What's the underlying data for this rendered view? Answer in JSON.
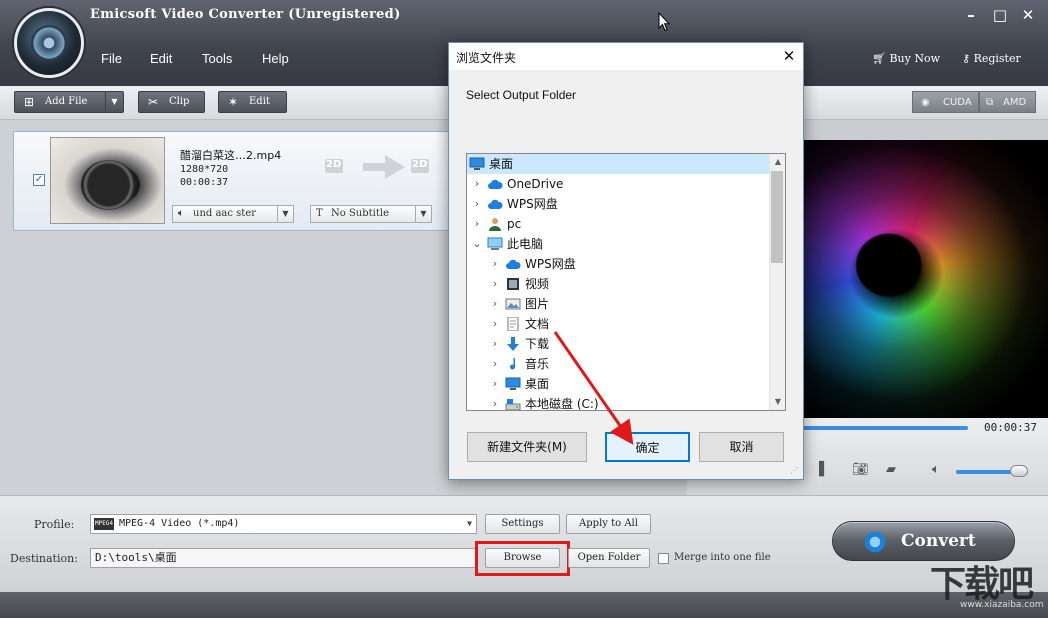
{
  "app": {
    "title": "Emicsoft Video Converter (Unregistered)",
    "menu": [
      "File",
      "Edit",
      "Tools",
      "Help"
    ],
    "buy_now": "Buy Now",
    "register": "Register"
  },
  "toolbar": {
    "add_file": "Add File",
    "clip": "Clip",
    "edit": "Edit",
    "cuda": "CUDA",
    "amd": "AMD"
  },
  "file": {
    "name": "醋溜白菜这…2.mp4",
    "resolution": "1280*720",
    "duration": "00:00:37",
    "badge_in": "2D",
    "badge_out": "2D",
    "audio": "und aac ster",
    "subtitle": "No Subtitle",
    "checked": true
  },
  "preview": {
    "time": "00:00:37",
    "seek_progress": 1.0,
    "volume": 0.8
  },
  "bottom": {
    "profile_label": "Profile:",
    "profile_value": "MPEG-4 Video (*.mp4)",
    "profile_badge": "MPEG4",
    "settings": "Settings",
    "apply_to_all": "Apply to All",
    "destination_label": "Destination:",
    "destination_value": "D:\\tools\\桌面",
    "browse": "Browse",
    "open_folder": "Open Folder",
    "merge": "Merge into one file",
    "convert": "Convert"
  },
  "dialog": {
    "title": "浏览文件夹",
    "label": "Select Output Folder",
    "tree": [
      {
        "label": "桌面",
        "level": 0,
        "icon": "desktop-icon",
        "chevron": "",
        "selected": true
      },
      {
        "label": "OneDrive",
        "level": 1,
        "icon": "cloud-icon",
        "chevron": ">"
      },
      {
        "label": "WPS网盘",
        "level": 1,
        "icon": "cloud-icon",
        "chevron": ">"
      },
      {
        "label": "pc",
        "level": 1,
        "icon": "user-icon",
        "chevron": ">"
      },
      {
        "label": "此电脑",
        "level": 1,
        "icon": "computer-icon",
        "chevron": "v"
      },
      {
        "label": "WPS网盘",
        "level": 2,
        "icon": "cloud-icon",
        "chevron": ">"
      },
      {
        "label": "视频",
        "level": 2,
        "icon": "video-folder-icon",
        "chevron": ">"
      },
      {
        "label": "图片",
        "level": 2,
        "icon": "picture-folder-icon",
        "chevron": ">"
      },
      {
        "label": "文档",
        "level": 2,
        "icon": "document-folder-icon",
        "chevron": ">"
      },
      {
        "label": "下载",
        "level": 2,
        "icon": "download-icon",
        "chevron": ">"
      },
      {
        "label": "音乐",
        "level": 2,
        "icon": "music-icon",
        "chevron": ">"
      },
      {
        "label": "桌面",
        "level": 2,
        "icon": "desktop-icon",
        "chevron": ">"
      },
      {
        "label": "本地磁盘 (C:)",
        "level": 2,
        "icon": "drive-icon",
        "chevron": ">"
      }
    ],
    "new_folder": "新建文件夹(M)",
    "ok": "确定",
    "cancel": "取消"
  },
  "watermark": {
    "text": "下载吧",
    "url": "www.xiazaiba.com"
  },
  "colors": {
    "accent_blue": "#0078d7",
    "highlight_red": "#e01818",
    "title_bar": "#3f434c"
  }
}
